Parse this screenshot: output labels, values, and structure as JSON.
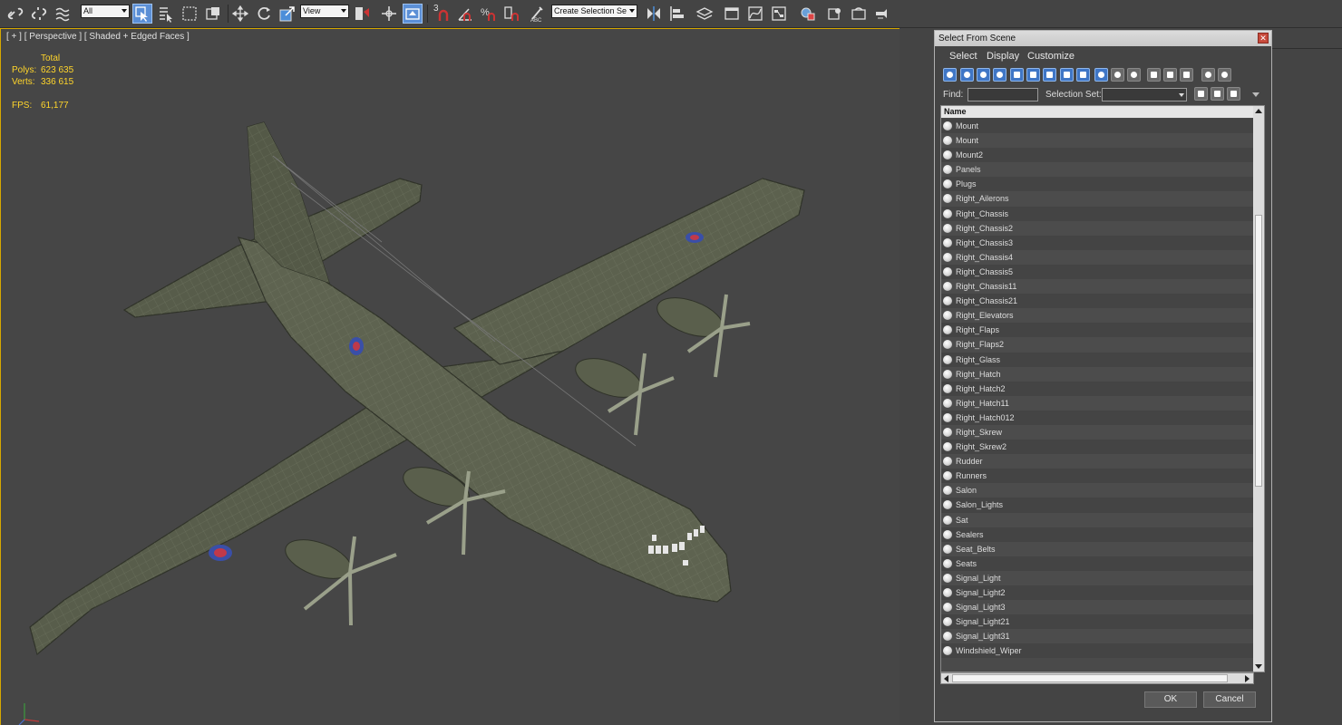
{
  "toolbar": {
    "selection_filter": "All",
    "ref_coord": "View",
    "named_selection_placeholder": "Create Selection Se",
    "snap_label": "3",
    "icons": [
      "link-icon",
      "unlink-icon",
      "bind-spacewarp-icon",
      "select-object-icon",
      "select-by-name-icon",
      "rect-region-icon",
      "window-crossing-icon",
      "move-icon",
      "rotate-icon",
      "scale-icon",
      "pivot-icon",
      "select-manipulate-icon",
      "snap-toggle-icon",
      "angle-snap-icon",
      "percent-snap-icon",
      "spinner-snap-icon",
      "edit-named-sets-icon",
      "mirror-icon",
      "align-icon",
      "layer-icon",
      "graphite-icon",
      "curve-editor-icon",
      "schematic-icon",
      "material-editor-icon",
      "render-setup-icon",
      "rendered-frame-icon",
      "render-icon"
    ]
  },
  "viewport": {
    "label": "[ + ] [ Perspective ] [ Shaded + Edged Faces ]",
    "stats": {
      "total_label": "Total",
      "polys_label": "Polys:",
      "polys_value": "623 635",
      "verts_label": "Verts:",
      "verts_value": "336 615",
      "fps_label": "FPS:",
      "fps_value": "61,177"
    }
  },
  "dialog": {
    "title": "Select From Scene",
    "close": "✕",
    "menu": [
      "Select",
      "Display",
      "Customize"
    ],
    "find_label": "Find:",
    "selection_set_label": "Selection Set:",
    "column_header": "Name",
    "items": [
      "Mount",
      "Mount",
      "Mount2",
      "Panels",
      "Plugs",
      "Right_Ailerons",
      "Right_Chassis",
      "Right_Chassis2",
      "Right_Chassis3",
      "Right_Chassis4",
      "Right_Chassis5",
      "Right_Chassis11",
      "Right_Chassis21",
      "Right_Elevators",
      "Right_Flaps",
      "Right_Flaps2",
      "Right_Glass",
      "Right_Hatch",
      "Right_Hatch2",
      "Right_Hatch11",
      "Right_Hatch012",
      "Right_Skrew",
      "Right_Skrew2",
      "Rudder",
      "Runners",
      "Salon",
      "Salon_Lights",
      "Sat",
      "Sealers",
      "Seat_Belts",
      "Seats",
      "Signal_Light",
      "Signal_Light2",
      "Signal_Light3",
      "Signal_Light21",
      "Signal_Light31",
      "Windshield_Wiper"
    ],
    "ok_label": "OK",
    "cancel_label": "Cancel"
  },
  "colors": {
    "viewport_bg": "#464646",
    "active_border": "#d6a800",
    "stats_text": "#ffd52b",
    "toolbar_active": "#5b8fd6",
    "plane_body": "#5a5f4c",
    "roundel_blue": "#3a4fa8",
    "roundel_red": "#c0394a"
  }
}
